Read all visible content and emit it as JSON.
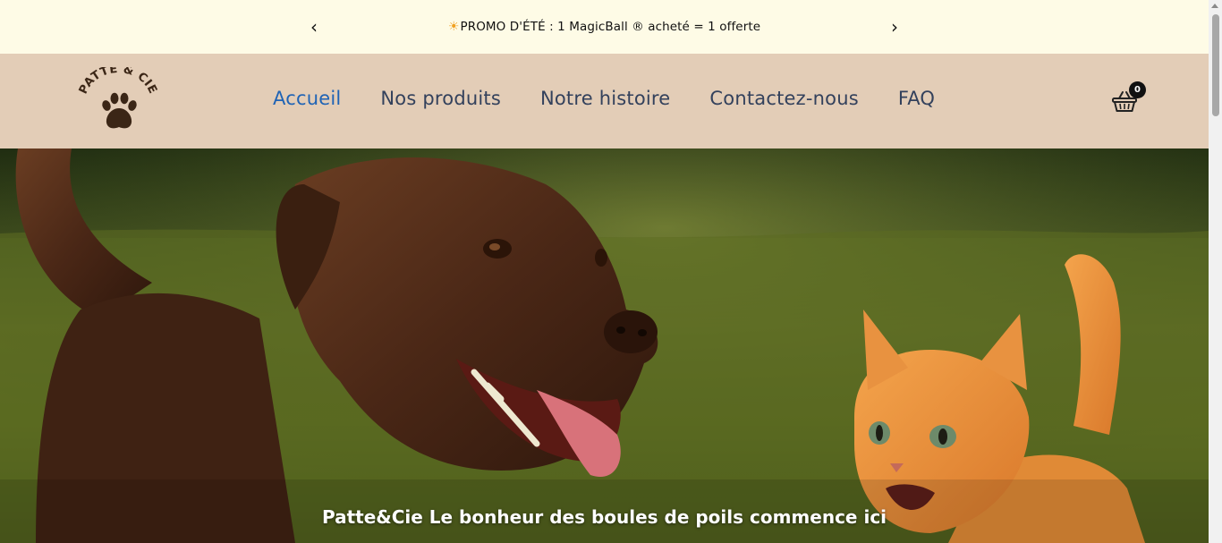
{
  "announcement": {
    "prev_icon": "chevron-left-icon",
    "next_icon": "chevron-right-icon",
    "prev_label": "‹",
    "next_label": "›",
    "sun_icon": "☀",
    "message": "PROMO D'ÉTÉ : 1 MagicBall ® acheté = 1 offerte"
  },
  "header": {
    "logo_text": "PATTE & CIE",
    "nav": [
      {
        "label": "Accueil",
        "active": true
      },
      {
        "label": "Nos produits",
        "active": false
      },
      {
        "label": "Notre histoire",
        "active": false
      },
      {
        "label": "Contactez-nous",
        "active": false
      },
      {
        "label": "FAQ",
        "active": false
      }
    ],
    "cart": {
      "icon": "basket-icon",
      "count": "0"
    }
  },
  "hero": {
    "caption": "Patte&Cie Le bonheur des boules de poils commence ici"
  },
  "colors": {
    "announce_bg": "#fefbe6",
    "header_bg": "#e3cdb7",
    "nav_text": "#33415c",
    "nav_active": "#1f63b5",
    "logo_brown": "#3b2616"
  }
}
